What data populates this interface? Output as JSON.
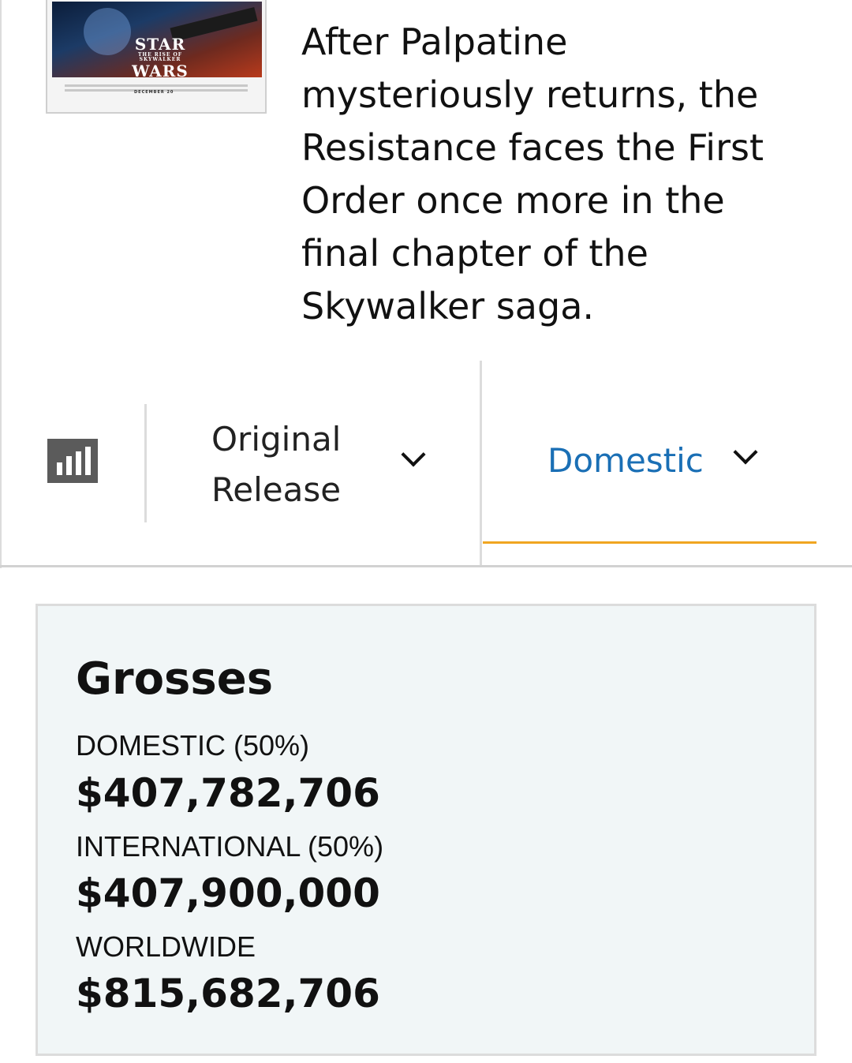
{
  "poster": {
    "logo_line1": "STAR",
    "logo_subtitle": "THE RISE OF SKYWALKER",
    "logo_line2": "WARS",
    "release_date": "DECEMBER 20"
  },
  "synopsis": {
    "lines": [
      "After Palpatine",
      "mysteriously returns, the",
      "Resistance faces the First",
      "Order once more in the",
      "final chapter of the",
      "Skywalker saga."
    ]
  },
  "toolbar": {
    "chart_icon": "bar-chart-icon",
    "release_selector": {
      "line1": "Original",
      "line2": "Release",
      "icon": "chevron-down-icon"
    },
    "market_selector": {
      "label": "Domestic",
      "icon": "chevron-down-icon"
    },
    "colors": {
      "active_text": "#1a6fb5",
      "active_underline": "#f0a521"
    }
  },
  "grosses": {
    "title": "Grosses",
    "domestic": {
      "label": "DOMESTIC (50%)",
      "value": "$407,782,706"
    },
    "international": {
      "label": "INTERNATIONAL (50%)",
      "value": "$407,900,000"
    },
    "worldwide": {
      "label": "WORLDWIDE",
      "value": "$815,682,706"
    }
  }
}
